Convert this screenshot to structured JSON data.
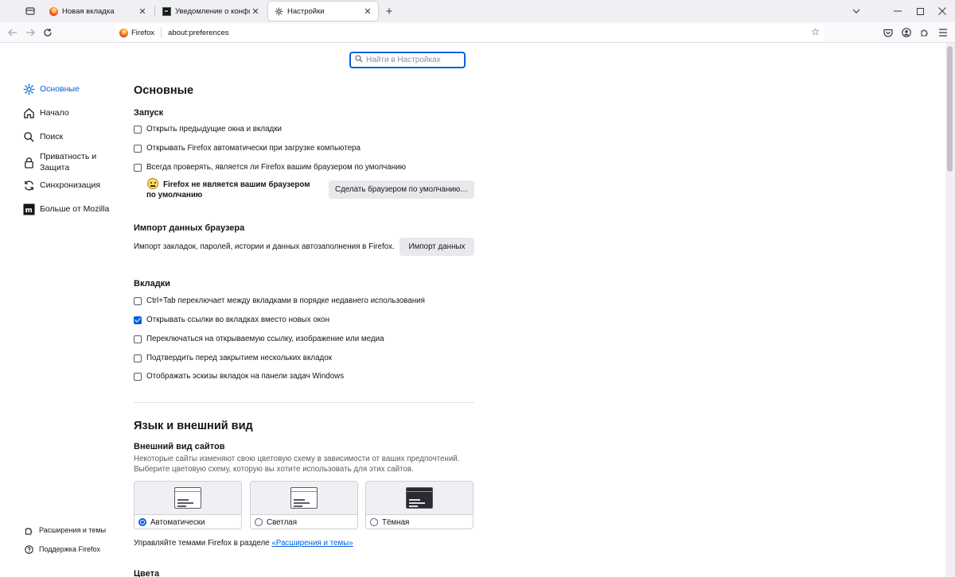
{
  "browser": {
    "tabs": [
      {
        "title": "Новая вкладка",
        "icon": "firefox-icon",
        "active": false
      },
      {
        "title": "Уведомление о конфиденциальности",
        "icon": "terminal-icon",
        "active": false
      },
      {
        "title": "Настройки",
        "icon": "gear-icon",
        "active": true
      }
    ],
    "new_tab_symbol": "+",
    "url": {
      "identity_label": "Firefox",
      "value": "about:preferences"
    }
  },
  "search": {
    "placeholder": "Найти в Настройках"
  },
  "sidebar": {
    "items": [
      {
        "label": "Основные",
        "icon": "gear-icon",
        "active": true
      },
      {
        "label": "Начало",
        "icon": "home-icon",
        "active": false
      },
      {
        "label": "Поиск",
        "icon": "search-icon",
        "active": false
      },
      {
        "label_line1": "Приватность и",
        "label_line2": "Защита",
        "icon": "lock-icon",
        "active": false
      },
      {
        "label": "Синхронизация",
        "icon": "sync-icon",
        "active": false
      },
      {
        "label": "Больше от Mozilla",
        "icon": "mozilla-icon",
        "active": false
      }
    ],
    "bottom": [
      {
        "label": "Расширения и темы",
        "icon": "puzzle-icon"
      },
      {
        "label": "Поддержка Firefox",
        "icon": "help-icon"
      }
    ]
  },
  "general": {
    "title": "Основные",
    "startup": {
      "title": "Запуск",
      "options": [
        {
          "label": "Открыть предыдущие окна и вкладки",
          "checked": false
        },
        {
          "label": "Открывать Firefox автоматически при загрузке компьютера",
          "checked": false
        },
        {
          "label": "Всегда проверять, является ли Firefox вашим браузером по умолчанию",
          "checked": false
        }
      ],
      "default_warning": "Firefox не является вашим браузером по умолчанию",
      "make_default_button": "Сделать браузером по умолчанию…"
    },
    "import": {
      "title": "Импорт данных браузера",
      "description": "Импорт закладок, паролей, истории и данных автозаполнения в Firefox.",
      "button": "Импорт данных"
    },
    "tabs": {
      "title": "Вкладки",
      "options": [
        {
          "label": "Ctrl+Tab переключает между вкладками в порядке недавнего использования",
          "checked": false
        },
        {
          "label": "Открывать ссылки во вкладках вместо новых окон",
          "checked": true
        },
        {
          "label": "Переключаться на открываемую ссылку, изображение или медиа",
          "checked": false
        },
        {
          "label": "Подтвердить перед закрытием нескольких вкладок",
          "checked": false
        },
        {
          "label": "Отображать эскизы вкладок на панели задач Windows",
          "checked": false
        }
      ]
    }
  },
  "language_appearance": {
    "title": "Язык и внешний вид",
    "website_appearance": {
      "title": "Внешний вид сайтов",
      "description_line1": "Некоторые сайты изменяют свою цветовую схему в зависимости от ваших предпочтений.",
      "description_line2": "Выберите цветовую схему, которую вы хотите использовать для этих сайтов.",
      "themes": [
        {
          "label": "Автоматически",
          "selected": true,
          "style": "light"
        },
        {
          "label": "Светлая",
          "selected": false,
          "style": "light"
        },
        {
          "label": "Тёмная",
          "selected": false,
          "style": "dark"
        }
      ],
      "manage_prefix": "Управляйте темами Firefox в разделе ",
      "manage_link": "«Расширения и темы»"
    },
    "colors_title": "Цвета"
  },
  "colors": {
    "accent": "#0061e0",
    "text": "#15141a",
    "muted": "#5b5b66",
    "tabstrip_bg": "#f0f0f4"
  }
}
